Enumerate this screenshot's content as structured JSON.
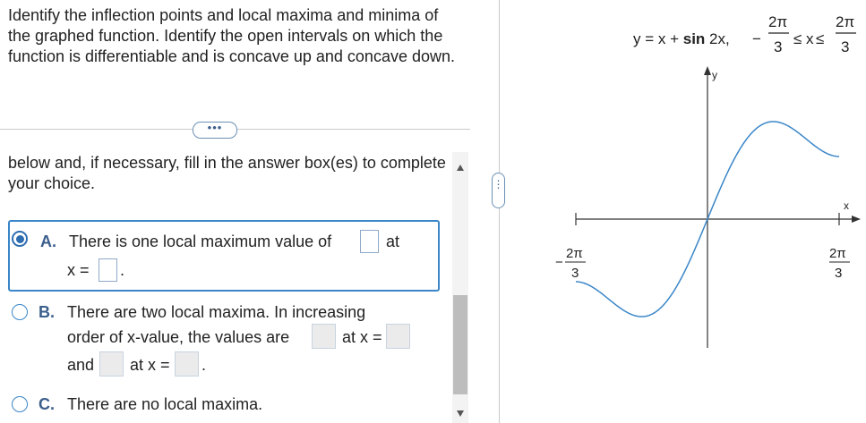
{
  "question": {
    "text": "Identify the inflection points and local maxima and minima of the graphed function. Identify the open intervals on which the function is differentiable and is concave up and concave down."
  },
  "expand_button": {
    "label": "•••"
  },
  "instruction": {
    "text": "below and, if necessary, fill in the answer box(es) to complete your choice."
  },
  "choices": {
    "a": {
      "letter": "A.",
      "text_1": "There is one local maximum value of",
      "text_2": "at",
      "text_3": "x =",
      "text_4": ".",
      "selected": true
    },
    "b": {
      "letter": "B.",
      "text_1": "There are two local maxima. In increasing",
      "text_2": "order of x-value, the values are",
      "text_3": "at x =",
      "text_4": "and",
      "text_5": "at x =",
      "text_6": ".",
      "selected": false
    },
    "c": {
      "letter": "C.",
      "text": "There are no local maxima.",
      "selected": false
    }
  },
  "graph": {
    "equation": "y = x + ",
    "equation_bold": "sin",
    "equation_tail": " 2x,",
    "domain_minus": "−",
    "frac_num": "2π",
    "frac_den": "3",
    "leq": "≤",
    "x_var": "x",
    "y_axis_label": "y",
    "x_axis_label": "x",
    "left_tick_sign": "−",
    "left_tick_num": "2π",
    "left_tick_den": "3",
    "right_tick_num": "2π",
    "right_tick_den": "3"
  },
  "colors": {
    "accent": "#3a86c8",
    "curve": "#3a86c8",
    "text": "#222222"
  }
}
